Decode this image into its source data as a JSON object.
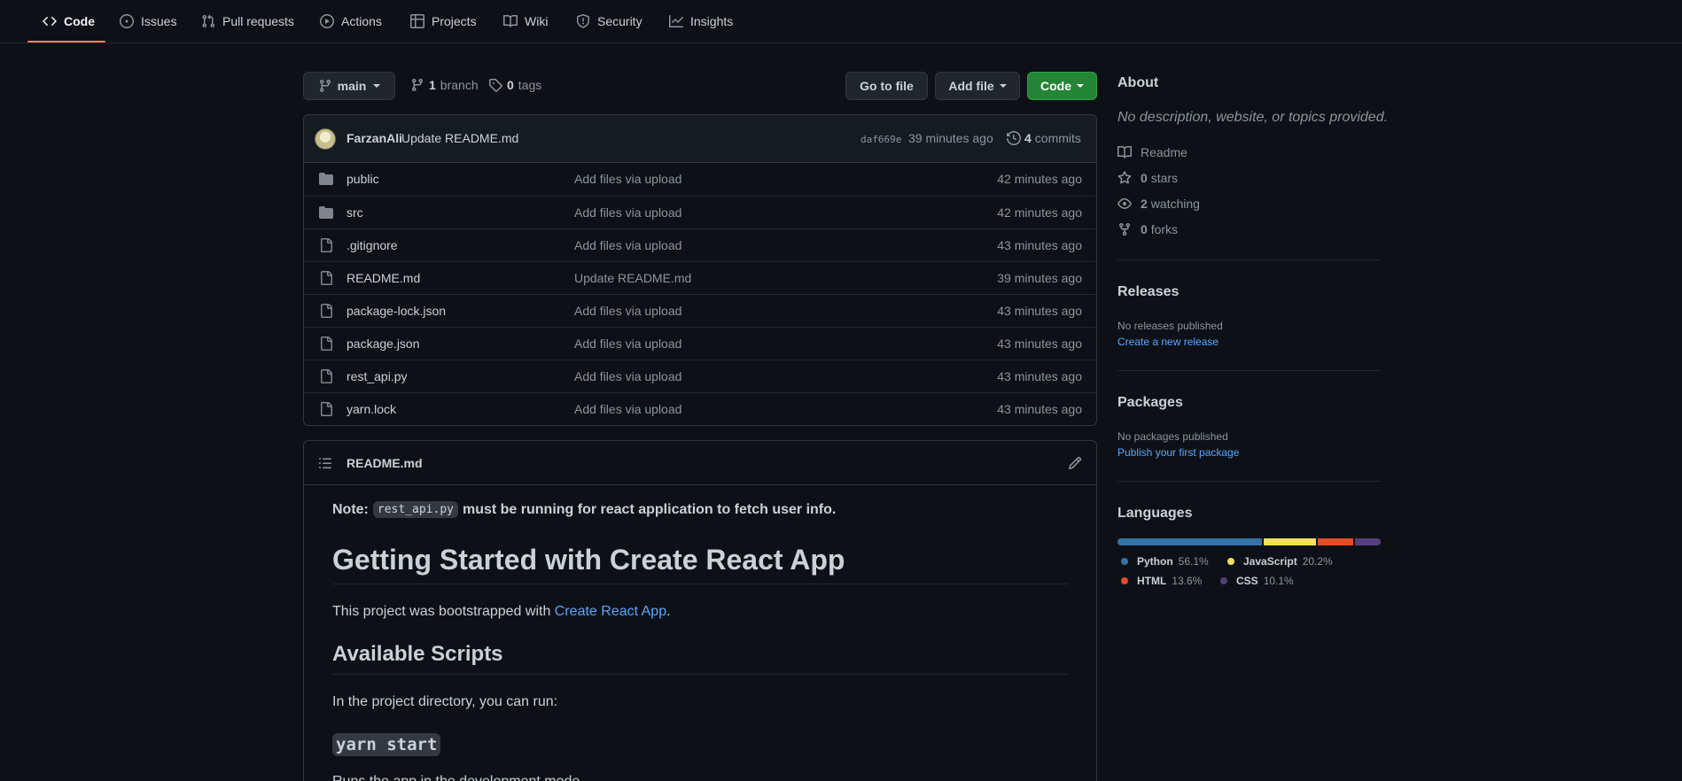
{
  "repo_nav": {
    "tabs": [
      {
        "label": "Code",
        "icon": "code-icon",
        "active": true
      },
      {
        "label": "Issues",
        "icon": "issue-icon"
      },
      {
        "label": "Pull requests",
        "icon": "pull-request-icon"
      },
      {
        "label": "Actions",
        "icon": "play-icon"
      },
      {
        "label": "Projects",
        "icon": "table-icon"
      },
      {
        "label": "Wiki",
        "icon": "book-icon"
      },
      {
        "label": "Security",
        "icon": "shield-icon"
      },
      {
        "label": "Insights",
        "icon": "graph-icon"
      }
    ]
  },
  "file_nav": {
    "branch": "main",
    "branch_count": "1",
    "branch_label": "branch",
    "tag_count": "0",
    "tag_label": "tags",
    "go_to_file": "Go to file",
    "add_file": "Add file",
    "code": "Code"
  },
  "commit": {
    "author": "FarzanAli",
    "message": "Update README.md",
    "sha": "daf669e",
    "time": "39 minutes ago",
    "count": "4",
    "count_label": "commits"
  },
  "files": [
    {
      "type": "folder",
      "name": "public",
      "message": "Add files via upload",
      "age": "42 minutes ago"
    },
    {
      "type": "folder",
      "name": "src",
      "message": "Add files via upload",
      "age": "42 minutes ago"
    },
    {
      "type": "file",
      "name": ".gitignore",
      "message": "Add files via upload",
      "age": "43 minutes ago"
    },
    {
      "type": "file",
      "name": "README.md",
      "message": "Update README.md",
      "age": "39 minutes ago"
    },
    {
      "type": "file",
      "name": "package-lock.json",
      "message": "Add files via upload",
      "age": "43 minutes ago"
    },
    {
      "type": "file",
      "name": "package.json",
      "message": "Add files via upload",
      "age": "43 minutes ago"
    },
    {
      "type": "file",
      "name": "rest_api.py",
      "message": "Add files via upload",
      "age": "43 minutes ago"
    },
    {
      "type": "file",
      "name": "yarn.lock",
      "message": "Add files via upload",
      "age": "43 minutes ago"
    }
  ],
  "readme": {
    "title": "README.md",
    "note_prefix": "Note:",
    "note_code": "rest_api.py",
    "note_suffix": "must be running for react application to fetch user info.",
    "h1": "Getting Started with Create React App",
    "intro_prefix": "This project was bootstrapped with",
    "intro_link": "Create React App",
    "intro_suffix": ".",
    "h2": "Available Scripts",
    "scripts_para": "In the project directory, you can run:",
    "h3_code": "yarn start",
    "run_para": "Runs the app in the development mode."
  },
  "sidebar": {
    "about_title": "About",
    "about_desc": "No description, website, or topics provided.",
    "readme": "Readme",
    "stars_count": "0",
    "stars_label": "stars",
    "watching_count": "2",
    "watching_label": "watching",
    "forks_count": "0",
    "forks_label": "forks",
    "releases_title": "Releases",
    "releases_none": "No releases published",
    "releases_link": "Create a new release",
    "packages_title": "Packages",
    "packages_none": "No packages published",
    "packages_link": "Publish your first package",
    "languages_title": "Languages",
    "languages": [
      {
        "name": "Python",
        "percent": "56.1%",
        "value": 56.1,
        "color": "#3572A5"
      },
      {
        "name": "JavaScript",
        "percent": "20.2%",
        "value": 20.2,
        "color": "#f1e05a"
      },
      {
        "name": "HTML",
        "percent": "13.6%",
        "value": 13.6,
        "color": "#e34c26"
      },
      {
        "name": "CSS",
        "percent": "10.1%",
        "value": 10.1,
        "color": "#563d7c"
      }
    ]
  }
}
